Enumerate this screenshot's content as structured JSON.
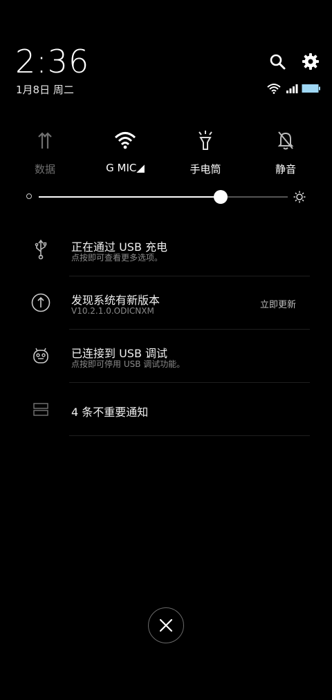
{
  "header": {
    "time": "2:36",
    "date": "1月8日 周二"
  },
  "toggles": [
    {
      "label": "数据",
      "icon": "data-arrows-icon",
      "active": false
    },
    {
      "label": " G  MIC◢",
      "icon": "wifi-icon",
      "active": true
    },
    {
      "label": "手电筒",
      "icon": "flashlight-icon",
      "active": true
    },
    {
      "label": "静音",
      "icon": "bell-mute-icon",
      "active": true
    }
  ],
  "brightness": {
    "level": 0.73
  },
  "notifications": [
    {
      "title": "正在通过 USB 充电",
      "subtitle": "点按即可查看更多选项。",
      "icon": "usb-icon"
    },
    {
      "title": "发现系统有新版本",
      "subtitle": "V10.2.1.0.ODICNXM",
      "action": "立即更新",
      "icon": "update-arrow-icon"
    },
    {
      "title": "已连接到 USB 调试",
      "subtitle": "点按即可停用 USB 调试功能。",
      "icon": "android-debug-icon"
    },
    {
      "title": "4 条不重要通知",
      "icon": "stack-icon"
    }
  ],
  "colors": {
    "background": "#000000",
    "battery": "#9fd8f5"
  }
}
